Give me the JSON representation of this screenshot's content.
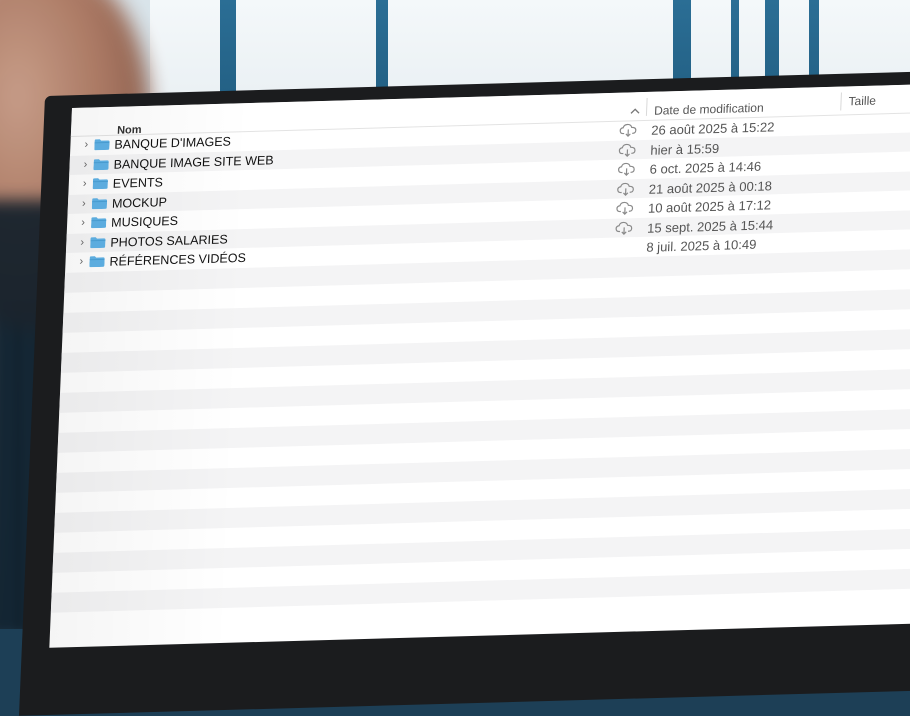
{
  "columns": {
    "name": "Nom",
    "date": "Date de modification",
    "size": "Taille"
  },
  "folders": [
    {
      "name": "BANQUE D'IMAGES",
      "date": "26 août 2025 à 15:22",
      "cloud": true
    },
    {
      "name": "BANQUE IMAGE SITE WEB",
      "date": "hier à 15:59",
      "cloud": true
    },
    {
      "name": "EVENTS",
      "date": "6 oct. 2025 à 14:46",
      "cloud": true
    },
    {
      "name": "MOCKUP",
      "date": "21 août 2025 à 00:18",
      "cloud": true
    },
    {
      "name": "MUSIQUES",
      "date": "10 août 2025 à 17:12",
      "cloud": true
    },
    {
      "name": "PHOTOS SALARIES",
      "date": "15 sept. 2025 à 15:44",
      "cloud": true
    },
    {
      "name": "RÉFÉRENCES VIDÉOS",
      "date": "8 juil. 2025 à 10:49",
      "cloud": false
    }
  ],
  "icons": {
    "expand": "chevron-right-icon",
    "folder": "folder-icon",
    "cloud": "cloud-download-icon",
    "sort": "chevron-up-icon"
  },
  "colors": {
    "folder": "#5fb2e6",
    "folder_tab": "#4aa0d6",
    "row_alt": "#f4f4f5",
    "text_date": "#555555",
    "bezel": "#1b1c1e"
  }
}
